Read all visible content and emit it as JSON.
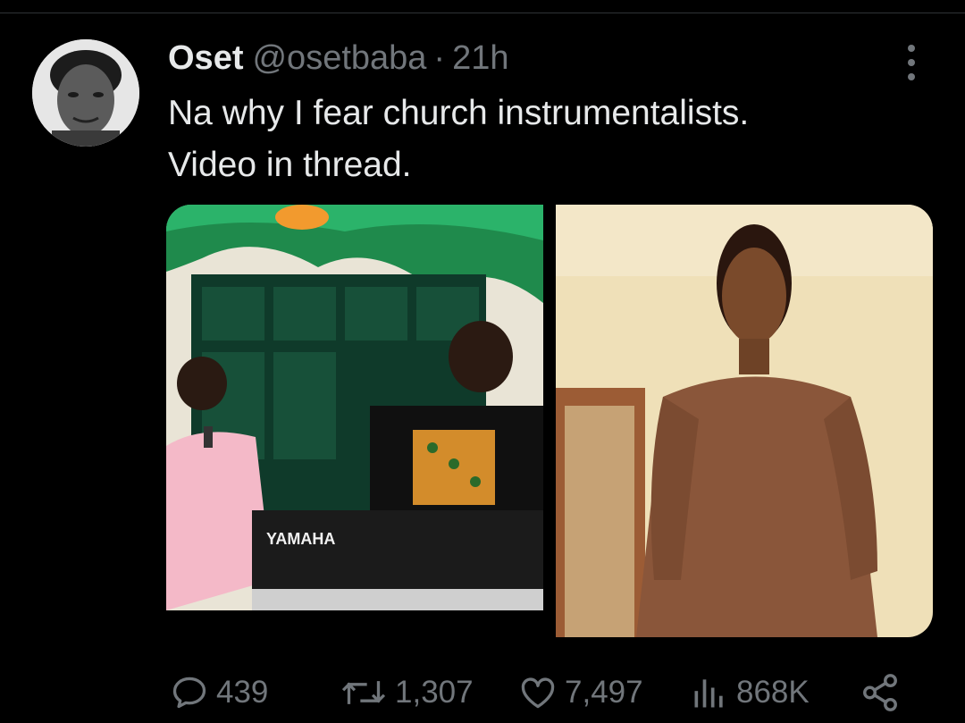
{
  "tweet": {
    "display_name": "Oset",
    "handle": "@osetbaba",
    "separator": "·",
    "time": "21h",
    "text_lines": [
      "Na why I fear church instrumentalists.",
      "Video in thread."
    ],
    "keyboard_brand": "YAMAHA"
  },
  "actions": {
    "replies": "439",
    "retweets": "1,307",
    "likes": "7,497",
    "views": "868K"
  },
  "icons": {
    "reply": "speech-bubble-icon",
    "retweet": "retweet-arrows-icon",
    "like": "heart-icon",
    "views": "bar-chart-icon",
    "share": "share-nodes-icon",
    "more": "vertical-ellipsis-icon"
  },
  "colors": {
    "background": "#000000",
    "primary_text": "#e7e9ea",
    "secondary_text": "#71767b",
    "divider": "#2f3336"
  }
}
